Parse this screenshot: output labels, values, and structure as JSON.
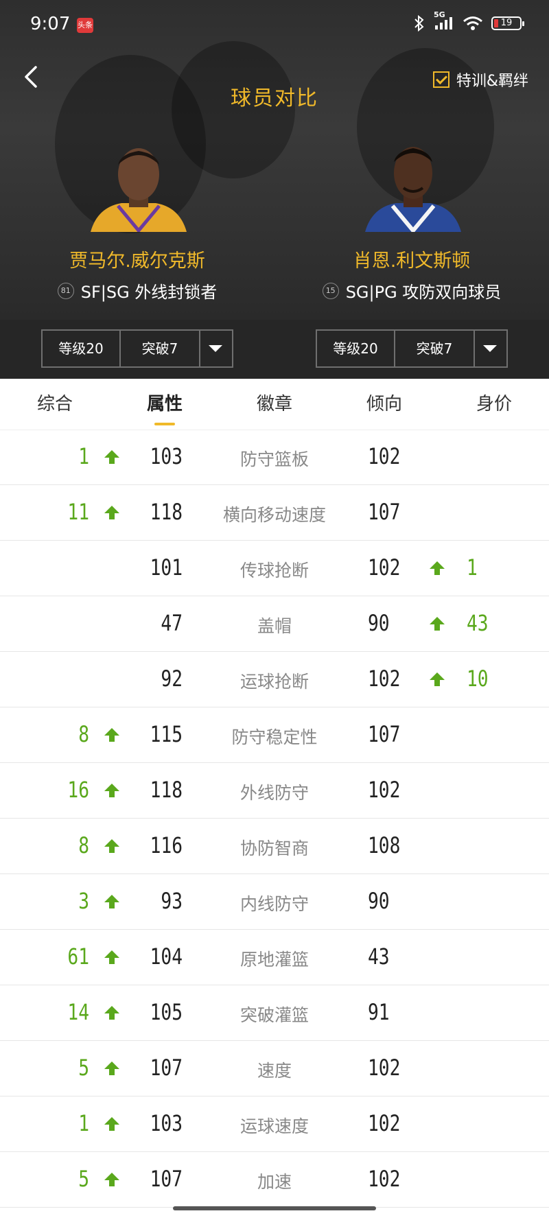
{
  "status_bar": {
    "time": "9:07",
    "news_badge": "头条",
    "network": "5G",
    "battery": "19"
  },
  "header": {
    "title": "球员对比",
    "toggle_label": "特训&羁绊"
  },
  "players": [
    {
      "name": "贾马尔.威尔克斯",
      "rating": "81",
      "info": "SF|SG 外线封锁者",
      "level": "等级20",
      "breakthrough": "突破7"
    },
    {
      "name": "肖恩.利文斯顿",
      "rating": "15",
      "info": "SG|PG 攻防双向球员",
      "level": "等级20",
      "breakthrough": "突破7"
    }
  ],
  "tabs": [
    "综合",
    "属性",
    "徽章",
    "倾向",
    "身价"
  ],
  "active_tab": "属性",
  "rows": [
    {
      "left_diff": "1",
      "left": "103",
      "label": "防守篮板",
      "right": "102",
      "right_diff": ""
    },
    {
      "left_diff": "11",
      "left": "118",
      "label": "横向移动速度",
      "right": "107",
      "right_diff": ""
    },
    {
      "left_diff": "",
      "left": "101",
      "label": "传球抢断",
      "right": "102",
      "right_diff": "1"
    },
    {
      "left_diff": "",
      "left": "47",
      "label": "盖帽",
      "right": "90",
      "right_diff": "43"
    },
    {
      "left_diff": "",
      "left": "92",
      "label": "运球抢断",
      "right": "102",
      "right_diff": "10"
    },
    {
      "left_diff": "8",
      "left": "115",
      "label": "防守稳定性",
      "right": "107",
      "right_diff": ""
    },
    {
      "left_diff": "16",
      "left": "118",
      "label": "外线防守",
      "right": "102",
      "right_diff": ""
    },
    {
      "left_diff": "8",
      "left": "116",
      "label": "协防智商",
      "right": "108",
      "right_diff": ""
    },
    {
      "left_diff": "3",
      "left": "93",
      "label": "内线防守",
      "right": "90",
      "right_diff": ""
    },
    {
      "left_diff": "61",
      "left": "104",
      "label": "原地灌篮",
      "right": "43",
      "right_diff": ""
    },
    {
      "left_diff": "14",
      "left": "105",
      "label": "突破灌篮",
      "right": "91",
      "right_diff": ""
    },
    {
      "left_diff": "5",
      "left": "107",
      "label": "速度",
      "right": "102",
      "right_diff": ""
    },
    {
      "left_diff": "1",
      "left": "103",
      "label": "运球速度",
      "right": "102",
      "right_diff": ""
    },
    {
      "left_diff": "5",
      "left": "107",
      "label": "加速",
      "right": "102",
      "right_diff": ""
    }
  ],
  "colors": {
    "accent": "#f0b92a",
    "positive": "#5aa81c"
  }
}
